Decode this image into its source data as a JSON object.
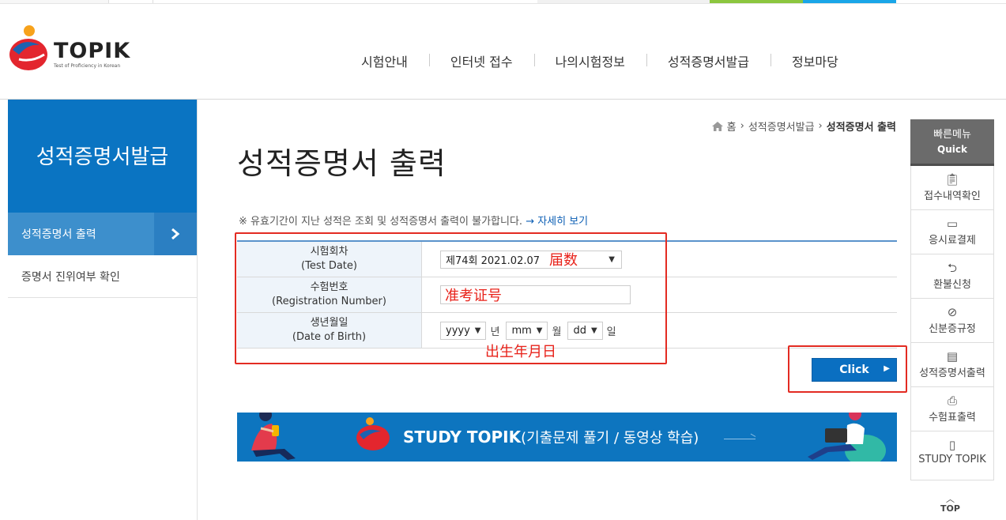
{
  "header": {
    "logo_text": "TOPIK",
    "logo_sub": "Test of Proficiency in Korean",
    "nav": [
      "시험안내",
      "인터넷 접수",
      "나의시험정보",
      "성적증명서발급",
      "정보마당"
    ]
  },
  "sidebar": {
    "title": "성적증명서발급",
    "items": [
      {
        "label": "성적증명서 출력",
        "active": true
      },
      {
        "label": "증명서 진위여부 확인",
        "active": false
      }
    ]
  },
  "breadcrumb": {
    "home": "홈",
    "level1": "성적증명서발급",
    "current": "성적증명서 출력"
  },
  "page": {
    "title": "성적증명서 출력",
    "notice": "※ 유효기간이 지난 성적은 조회 및 성적증명서 출력이 불가합니다.",
    "notice_link": "→ 자세히 보기"
  },
  "form": {
    "rows": [
      {
        "label_ko": "시험회차",
        "label_en": "(Test Date)"
      },
      {
        "label_ko": "수험번호",
        "label_en": "(Registration Number)"
      },
      {
        "label_ko": "생년월일",
        "label_en": "(Date of Birth)"
      }
    ],
    "test_date_value": "제74회 2021.02.07",
    "test_date_note": "届数",
    "reg_number_note": "准考证号",
    "birth": {
      "year": "yyyy",
      "year_unit": "년",
      "month": "mm",
      "month_unit": "월",
      "day": "dd",
      "day_unit": "일"
    },
    "birth_note": "出生年月日"
  },
  "click_button": "Click",
  "banner": {
    "title": "STUDY TOPIK",
    "subtitle": "(기출문제 풀기 / 동영상 학습)"
  },
  "quick": {
    "title": "빠른메뉴",
    "subtitle": "Quick",
    "items": [
      {
        "label": "접수내역확인",
        "icon": "clipboard-icon"
      },
      {
        "label": "응시료결제",
        "icon": "card-icon"
      },
      {
        "label": "환불신청",
        "icon": "return-icon"
      },
      {
        "label": "신분증규정",
        "icon": "prohibit-icon"
      },
      {
        "label": "성적증명서출력",
        "icon": "certificate-icon"
      },
      {
        "label": "수험표출력",
        "icon": "printer-icon"
      },
      {
        "label": "STUDY TOPIK",
        "icon": "book-icon"
      }
    ],
    "top": "TOP"
  },
  "colors": {
    "primary_blue": "#0a74c2",
    "active_blue": "#3d8fcc",
    "annotation_red": "#e32b22",
    "green": "#8cc63f",
    "cyan": "#1aa6e8"
  }
}
